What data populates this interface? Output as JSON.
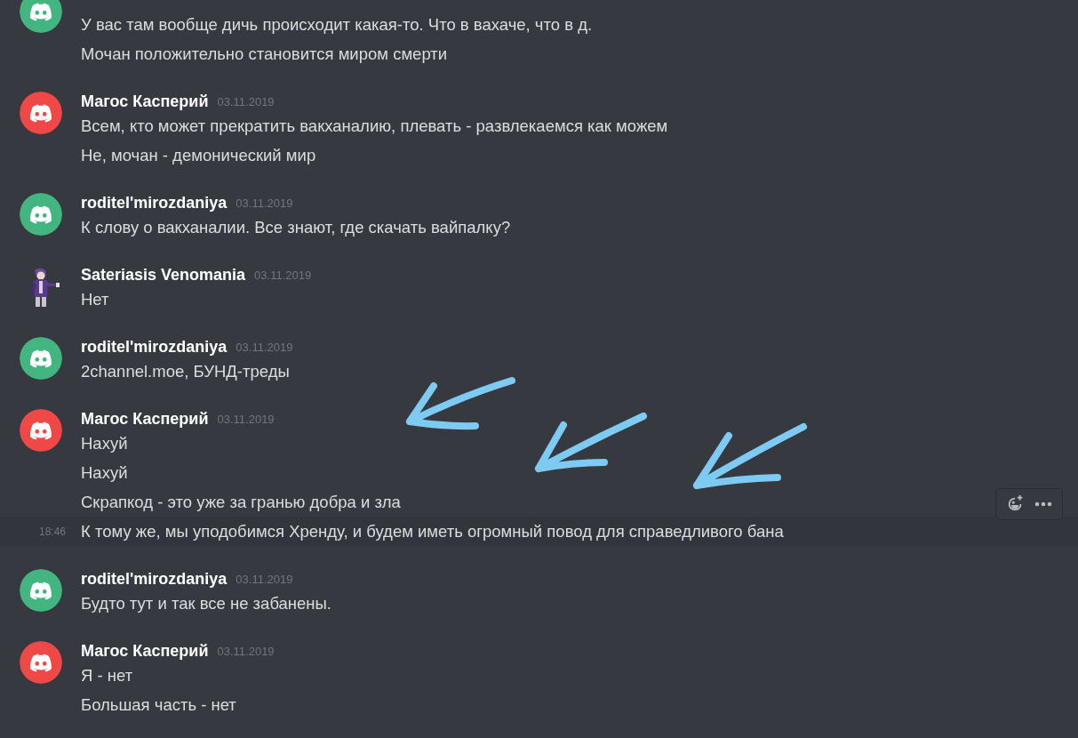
{
  "groups": [
    {
      "avatar": {
        "kind": "logo",
        "color": "#43b581"
      },
      "messages": [
        {
          "text": "У вас там вообще дичь происходит какая-то. Что в вахаче, что в д.",
          "hovered": false
        },
        {
          "text": "Мочан положительно становится миром смерти",
          "hovered": false
        }
      ]
    },
    {
      "author": "Магос Касперий",
      "date": "03.11.2019",
      "avatar": {
        "kind": "logo",
        "color": "#f04747"
      },
      "messages": [
        {
          "text": "Всем, кто может прекратить вакханалию, плевать - развлекаемся как можем",
          "hovered": false
        },
        {
          "text": "Не, мочан - демонический мир",
          "hovered": false
        }
      ]
    },
    {
      "author": "roditel'mirozdaniya",
      "date": "03.11.2019",
      "avatar": {
        "kind": "logo",
        "color": "#43b581"
      },
      "messages": [
        {
          "text": "К слову о вакханалии. Все знают, где скачать вайпалку?",
          "hovered": false
        }
      ]
    },
    {
      "author": "Sateriasis Venomania",
      "date": "03.11.2019",
      "avatar": {
        "kind": "picture"
      },
      "messages": [
        {
          "text": "Нет",
          "hovered": false
        }
      ]
    },
    {
      "author": "roditel'mirozdaniya",
      "date": "03.11.2019",
      "avatar": {
        "kind": "logo",
        "color": "#43b581"
      },
      "messages": [
        {
          "text": "2channel.moe, БУНД-треды",
          "hovered": false
        }
      ]
    },
    {
      "author": "Магос Касперий",
      "date": "03.11.2019",
      "avatar": {
        "kind": "logo",
        "color": "#f04747"
      },
      "messages": [
        {
          "text": "Нахуй",
          "hovered": false
        },
        {
          "text": "Нахуй",
          "hovered": false
        },
        {
          "text": "Скрапкод - это уже за гранью добра и зла",
          "hovered": false
        },
        {
          "text": "К тому же, мы уподобимся Хренду, и будем иметь огромный повод для справедливого бана",
          "hovered": true,
          "time": "18:46"
        }
      ]
    },
    {
      "author": "roditel'mirozdaniya",
      "date": "03.11.2019",
      "avatar": {
        "kind": "logo",
        "color": "#43b581"
      },
      "messages": [
        {
          "text": "Будто тут и так все не забанены.",
          "hovered": false
        }
      ]
    },
    {
      "author": "Магос Касперий",
      "date": "03.11.2019",
      "avatar": {
        "kind": "logo",
        "color": "#f04747"
      },
      "messages": [
        {
          "text": "Я - нет",
          "hovered": false
        },
        {
          "text": "Большая часть - нет",
          "hovered": false
        }
      ]
    }
  ]
}
